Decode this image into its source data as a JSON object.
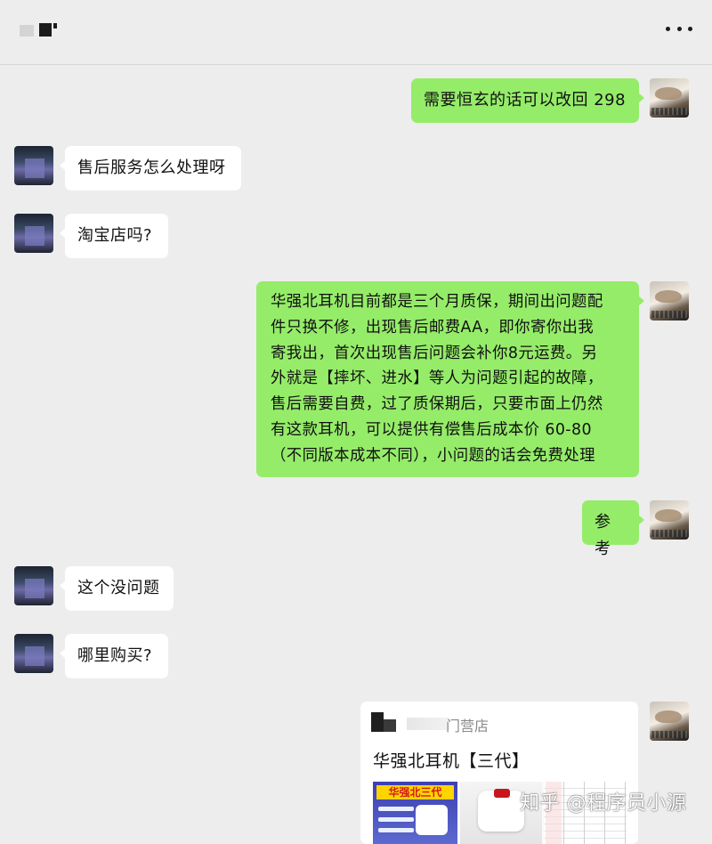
{
  "messages": {
    "m1": "需要恒玄的话可以改回 298",
    "m2": "售后服务怎么处理呀",
    "m3": "淘宝店吗?",
    "m4_lines": [
      "华强北耳机目前都是三个月质保，期间出问题配",
      "件只换不修，出现售后邮费AA，即你寄你出我",
      "寄我出，首次出现售后问题会补你8元运费。另",
      "外就是【摔坏、进水】等人为问题引起的故障，",
      "售后需要自费，过了质保期后，只要市面上仍然",
      "有这款耳机，可以提供有偿售后成本价 60-80",
      "（不同版本成本不同），小问题的话会免费处理"
    ],
    "m5": "参考",
    "m6": "这个没问题",
    "m7": "哪里购买?"
  },
  "card": {
    "shop_suffix": "门营店",
    "title": "华强北耳机【三代】",
    "image_banner": "华强北三代"
  },
  "watermark": "知乎 @程序员小源",
  "icons": {
    "more": "more-dots-icon"
  }
}
